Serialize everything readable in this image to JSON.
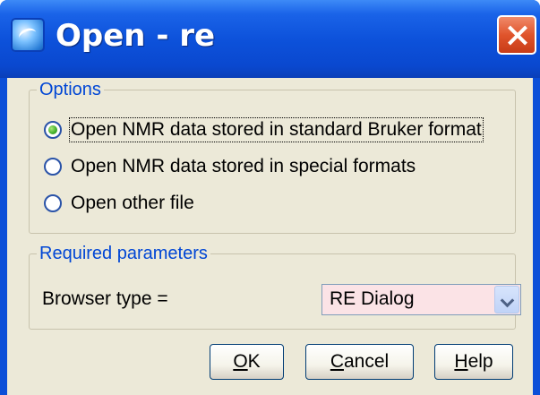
{
  "window": {
    "title": "Open - re",
    "icon": "topspin-app-icon",
    "close_icon": "close-icon"
  },
  "options": {
    "legend": "Options",
    "radios": [
      {
        "label": "Open NMR data stored in standard Bruker format",
        "checked": true
      },
      {
        "label": "Open NMR data stored in special formats",
        "checked": false
      },
      {
        "label": "Open other file",
        "checked": false
      }
    ]
  },
  "params": {
    "legend": "Required parameters",
    "browser_label": "Browser type =",
    "browser_value": "RE Dialog"
  },
  "buttons": {
    "ok_mnemonic": "O",
    "ok_rest": "K",
    "cancel_mnemonic": "C",
    "cancel_rest": "ancel",
    "help_mnemonic": "H",
    "help_rest": "elp"
  },
  "colors": {
    "title_bar": "#0a4fd8",
    "legend_text": "#0046d5",
    "select_bg": "#fbe3e6",
    "dialog_bg": "#ece9d8"
  }
}
